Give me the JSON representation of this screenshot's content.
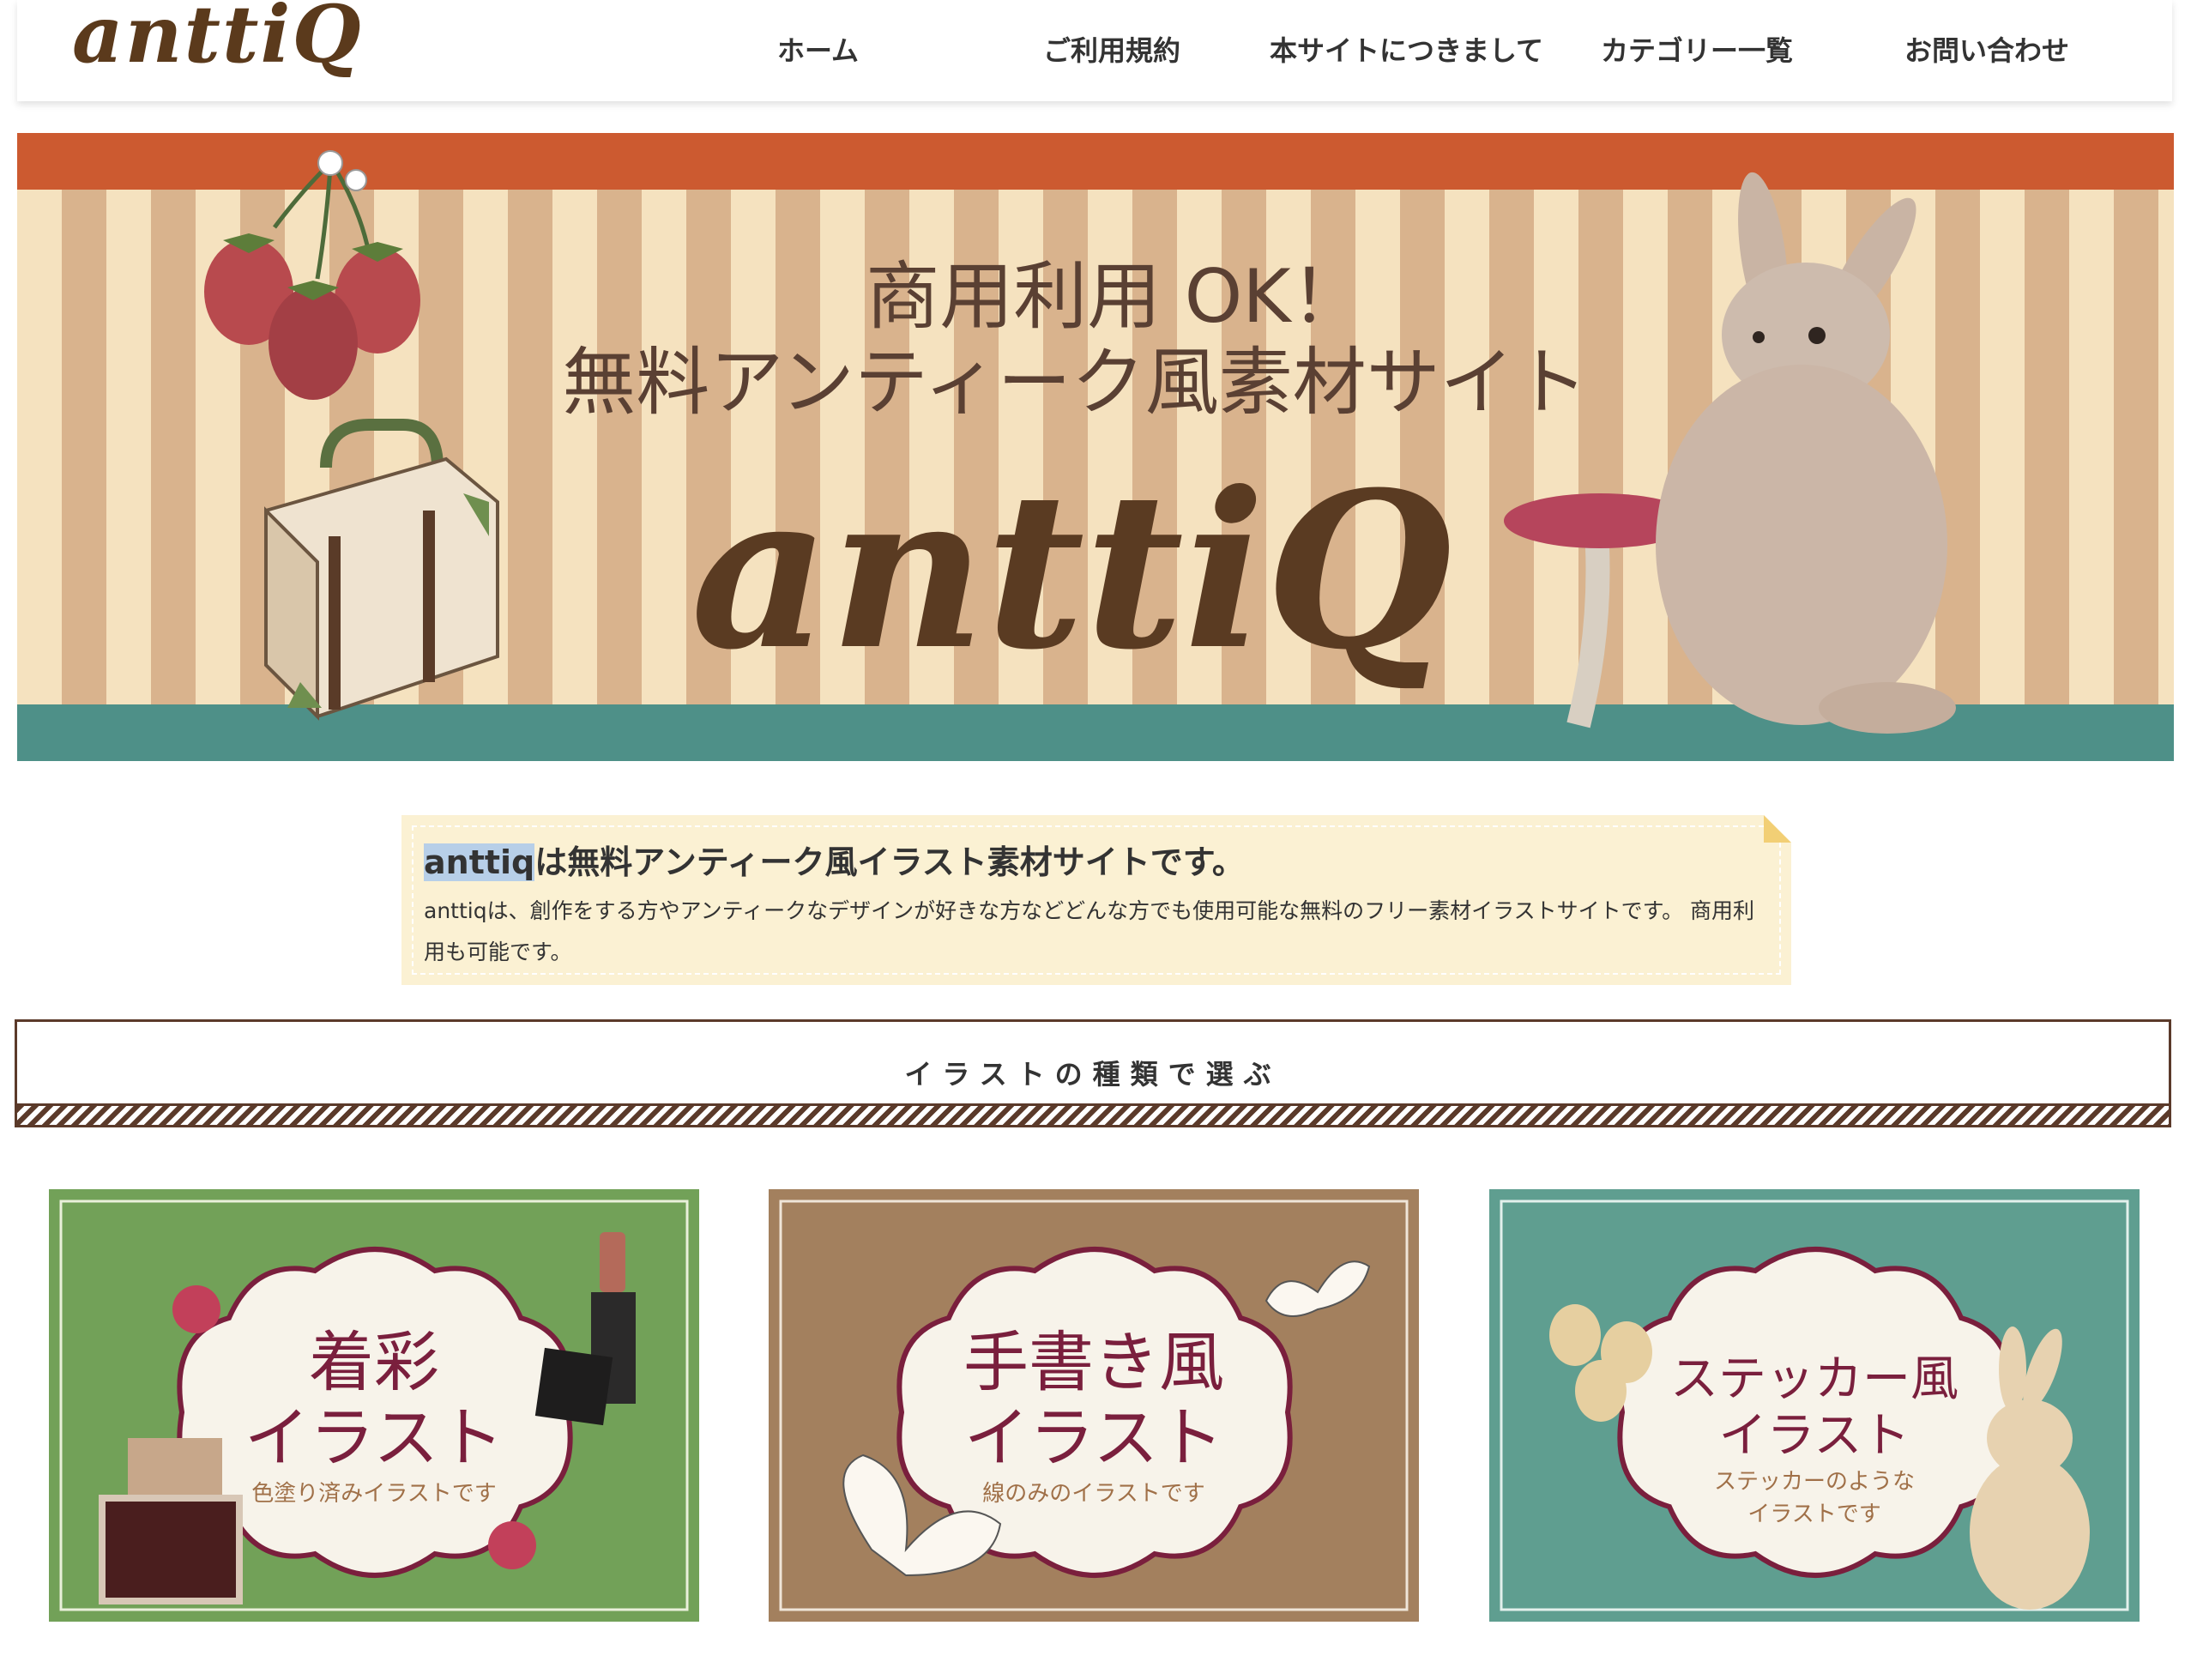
{
  "header": {
    "logo": "anttiQ",
    "nav": [
      "ホーム",
      "ご利用規約",
      "本サイトにつきまして",
      "カテゴリー一覧",
      "お問い合わせ"
    ]
  },
  "hero": {
    "line1": "商用利用 OK！",
    "line2": "無料アンティーク風素材サイト",
    "logo": "anttiQ",
    "colors": {
      "top_band": "#cc5a30",
      "bottom_band": "#4e9088",
      "stripe_a": "#f5e2bf",
      "stripe_b": "#d9b38d"
    }
  },
  "intro": {
    "title_highlight": "anttiq",
    "title_rest": "は無料アンティーク風イラスト素材サイトです。",
    "text": "anttiqは、創作をする方やアンティークなデザインが好きな方などどんな方でも使用可能な無料のフリー素材イラストサイトです。 商用利用も可能です。"
  },
  "section": {
    "title": "イラストの種類で選ぶ"
  },
  "cards": [
    {
      "title1": "着彩",
      "title2": "イラスト",
      "sub": "色塗り済みイラストです",
      "bg": "#72a158",
      "icons": [
        "flower-icon",
        "lipstick-icon",
        "perfume-bottle-icon"
      ]
    },
    {
      "title1": "手書き風",
      "title2": "イラスト",
      "sub": "線のみのイラストです",
      "bg": "#a3805e",
      "icons": [
        "butterfly-icon"
      ]
    },
    {
      "title1": "ステッカー風",
      "title2": "イラスト",
      "sub": "ステッカーのような",
      "sub2": "イラストです",
      "bg": "#5f9e90",
      "icons": [
        "strawberry-icon",
        "rabbit-icon"
      ]
    }
  ]
}
